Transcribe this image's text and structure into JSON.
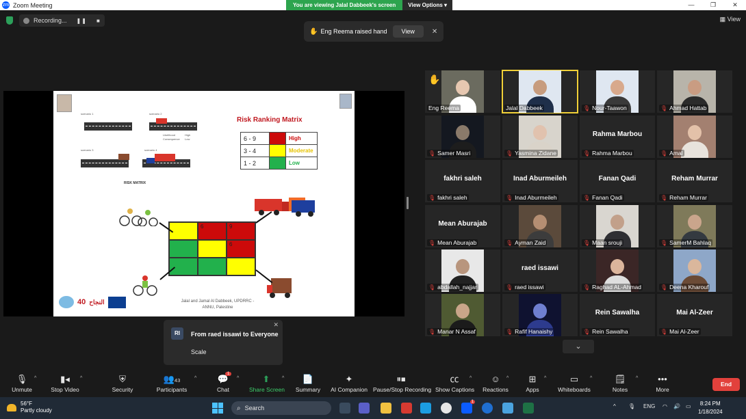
{
  "window": {
    "title": "Zoom Meeting",
    "view_options_label": "View Options",
    "viewing_banner": "You are viewing Jalal Dabbeek's screen"
  },
  "status": {
    "recording_label": "Recording...",
    "view_label": "View"
  },
  "toast": {
    "text": "Eng Reema raised hand",
    "view_button": "View"
  },
  "slide": {
    "title": "Risk Ranking Matrix",
    "ranking": [
      {
        "range": "6 - 9",
        "label": "High",
        "color": "#cc0a0a"
      },
      {
        "range": "3 - 4",
        "label": "Moderate",
        "color": "#ffff00"
      },
      {
        "range": "1 - 2",
        "label": "Low",
        "color": "#22b14c"
      }
    ],
    "mini_labels": [
      "scenario 1",
      "scenario 2",
      "scenario 3",
      "scenario 4",
      "Likelihood",
      "Consequence",
      "High",
      "Low"
    ],
    "risk_matrix_label": "RISK MATRIX",
    "matrix_cells": [
      {
        "text": "",
        "color": "#ffff00"
      },
      {
        "text": "6",
        "color": "#cc0a0a"
      },
      {
        "text": "9",
        "color": "#cc0a0a"
      },
      {
        "text": "",
        "color": "#22b14c"
      },
      {
        "text": "",
        "color": "#ffff00"
      },
      {
        "text": "6",
        "color": "#cc0a0a"
      },
      {
        "text": "",
        "color": "#22b14c"
      },
      {
        "text": "",
        "color": "#22b14c"
      },
      {
        "text": "",
        "color": "#ffff00"
      }
    ],
    "credit": "Jalal and Jamal Al Dabbeek, UPDRRC -ANNU, Palestine",
    "logo_40": "40",
    "logo_arabic": "النجاح"
  },
  "participants": [
    {
      "name": "Eng Reema",
      "video": true,
      "raised_hand": true,
      "muted": false,
      "bg": "#6b6b5f",
      "skin": "#e6c7b0",
      "cloth": "#ffffff"
    },
    {
      "name": "Jalal Dabbeek",
      "video": true,
      "active": true,
      "muted": false,
      "bg": "#dfe7f1",
      "skin": "#c79c7e",
      "cloth": "#1f2f4a"
    },
    {
      "name": "Nour-Taawon",
      "video": true,
      "muted": true,
      "bg": "#dfe7f1",
      "skin": "#d8a98c",
      "cloth": "#3a3a3a"
    },
    {
      "name": "Ahmad Hattab",
      "video": true,
      "muted": true,
      "bg": "#b8b4aa",
      "skin": "#c99c82",
      "cloth": "#2b2b2b"
    },
    {
      "name": "Samer Masri",
      "video": true,
      "muted": true,
      "bg": "#141820",
      "skin": "#8a7a6a",
      "cloth": "#1d1d1d"
    },
    {
      "name": "Yasmina Zidane",
      "video": true,
      "muted": true,
      "bg": "#d8d4cc",
      "skin": "#e1c2ae",
      "cloth": "#d9d3c9"
    },
    {
      "name": "Rahma Marbou",
      "video": false,
      "muted": true
    },
    {
      "name": "Amal",
      "video": true,
      "muted": true,
      "bg": "#a38070",
      "skin": "#e3c1a9",
      "cloth": "#e8e3dc"
    },
    {
      "name": "fakhri saleh",
      "video": false,
      "muted": true
    },
    {
      "name": "Inad Aburmeileh",
      "video": false,
      "muted": true
    },
    {
      "name": "Fanan Qadi",
      "video": false,
      "muted": true
    },
    {
      "name": "Reham Murrar",
      "video": false,
      "muted": true
    },
    {
      "name": "Mean Aburajab",
      "video": false,
      "muted": true
    },
    {
      "name": "Ayman Zaid",
      "video": true,
      "muted": true,
      "bg": "#5b4a3b",
      "skin": "#b58e72",
      "cloth": "#3c3c3c"
    },
    {
      "name": "Maan srouji",
      "video": true,
      "muted": true,
      "bg": "#d9d6d0",
      "skin": "#c2a08a",
      "cloth": "#2f2f33"
    },
    {
      "name": "SamerM Bahlaq",
      "video": true,
      "muted": true,
      "bg": "#7f7a5a",
      "skin": "#caa58c",
      "cloth": "#343a40"
    },
    {
      "name": "abdallah_najjar",
      "video": true,
      "muted": true,
      "bg": "#e8e8e8",
      "skin": "#b8957d",
      "cloth": "#222222"
    },
    {
      "name": "raed issawi",
      "video": false,
      "muted": true
    },
    {
      "name": "Raghad AL-Ahmad",
      "video": true,
      "muted": true,
      "bg": "#3b2626",
      "skin": "#dcb59c",
      "cloth": "#dedede"
    },
    {
      "name": "Deena Kharouf",
      "video": true,
      "muted": true,
      "bg": "#8ea7c8",
      "skin": "#dab79c",
      "cloth": "#6b4b36"
    },
    {
      "name": "Manar N Assaf",
      "video": true,
      "muted": true,
      "bg": "#4f5a32",
      "skin": "#c9a589",
      "cloth": "#1b1b1b"
    },
    {
      "name": "Rafif Hanaishy",
      "video": true,
      "muted": true,
      "bg": "#0f1230",
      "skin": "#6f7fd0",
      "cloth": "#2d3b8e"
    },
    {
      "name": "Rein Sawalha",
      "video": false,
      "muted": true
    },
    {
      "name": "Mai Al-Zeer",
      "video": false,
      "muted": true
    }
  ],
  "chat_popup": {
    "initials": "RI",
    "from": "From raed issawi to Everyone",
    "message": "Scale"
  },
  "toolbar": {
    "unmute": "Unmute",
    "stop_video": "Stop Video",
    "security": "Security",
    "participants": "Participants",
    "participants_count": "43",
    "chat": "Chat",
    "chat_badge": "1",
    "share_screen": "Share Screen",
    "summary": "Summary",
    "ai_companion": "AI Companion",
    "recording": "Pause/Stop Recording",
    "captions": "Show Captions",
    "reactions": "Reactions",
    "apps": "Apps",
    "whiteboards": "Whiteboards",
    "notes": "Notes",
    "more": "More",
    "end": "End"
  },
  "taskbar": {
    "temperature": "56°F",
    "weather": "Partly cloudy",
    "search_placeholder": "Search",
    "zoom_badge": "1",
    "language": "ENG",
    "time": "8:24 PM",
    "date": "1/18/2024"
  }
}
